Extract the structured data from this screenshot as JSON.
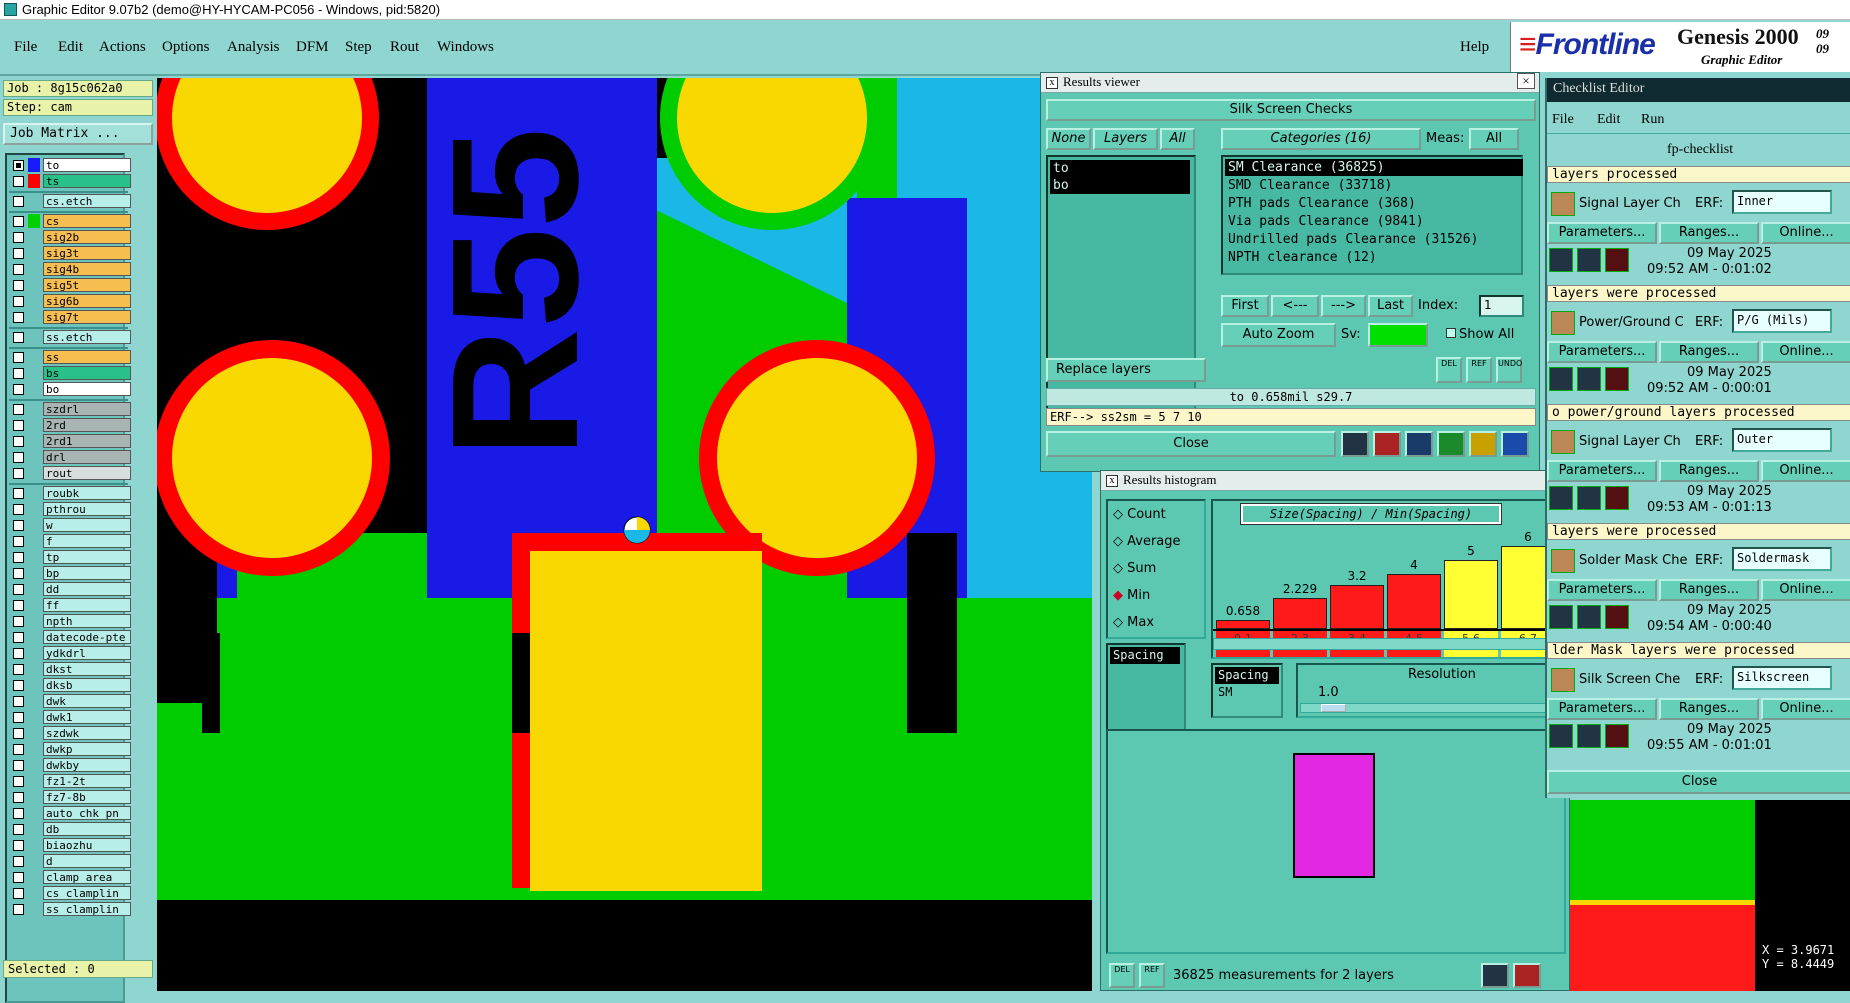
{
  "titlebar": {
    "title": "Graphic Editor 9.07b2 (demo@HY-HYCAM-PC056 - Windows, pid:5820)"
  },
  "menu": {
    "items": [
      "File",
      "Edit",
      "Actions",
      "Options",
      "Analysis",
      "DFM",
      "Step",
      "Rout",
      "Windows"
    ],
    "help": "Help"
  },
  "logo": {
    "brand": "Frontline",
    "product": "Genesis 2000",
    "subtitle": "Graphic Editor",
    "date_line1": "09",
    "date_line2": "09"
  },
  "left": {
    "job": "Job : 8g15c062a0",
    "step": "Step: cam",
    "job_matrix": "Job Matrix ...",
    "selected": "Selected : 0",
    "layers": [
      {
        "name": "to",
        "style": "wht",
        "color": "#1a1aff",
        "on": true
      },
      {
        "name": "ts",
        "style": "sol",
        "color": "#ff0000",
        "on": false
      },
      {
        "name": "cs.etch",
        "style": "cyn",
        "color": "",
        "on": false
      },
      {
        "name": "cs",
        "style": "sig",
        "color": "#00d000",
        "on": false
      },
      {
        "name": "sig2b",
        "style": "sig",
        "color": "",
        "on": false
      },
      {
        "name": "sig3t",
        "style": "sig",
        "color": "",
        "on": false
      },
      {
        "name": "sig4b",
        "style": "sig",
        "color": "",
        "on": false
      },
      {
        "name": "sig5t",
        "style": "sig",
        "color": "",
        "on": false
      },
      {
        "name": "sig6b",
        "style": "sig",
        "color": "",
        "on": false
      },
      {
        "name": "sig7t",
        "style": "sig",
        "color": "",
        "on": false
      },
      {
        "name": "ss.etch",
        "style": "cyn",
        "color": "",
        "on": false
      },
      {
        "name": "ss",
        "style": "sig",
        "color": "",
        "on": false
      },
      {
        "name": "bs",
        "style": "sol",
        "color": "",
        "on": false
      },
      {
        "name": "bo",
        "style": "wht",
        "color": "",
        "on": false
      },
      {
        "name": "szdrl",
        "style": "drl",
        "color": "",
        "on": false
      },
      {
        "name": "2rd",
        "style": "drl",
        "color": "",
        "on": false
      },
      {
        "name": "2rd1",
        "style": "drl",
        "color": "",
        "on": false
      },
      {
        "name": "drl",
        "style": "drl",
        "color": "",
        "on": false
      },
      {
        "name": "rout",
        "style": "grey",
        "color": "",
        "on": false
      },
      {
        "name": "roubk",
        "style": "cyn",
        "color": "",
        "on": false
      },
      {
        "name": "pthrou",
        "style": "cyn",
        "color": "",
        "on": false
      },
      {
        "name": "w",
        "style": "cyn",
        "color": "",
        "on": false
      },
      {
        "name": "f",
        "style": "cyn",
        "color": "",
        "on": false
      },
      {
        "name": "tp",
        "style": "cyn",
        "color": "",
        "on": false
      },
      {
        "name": "bp",
        "style": "cyn",
        "color": "",
        "on": false
      },
      {
        "name": "dd",
        "style": "cyn",
        "color": "",
        "on": false
      },
      {
        "name": "ff",
        "style": "cyn",
        "color": "",
        "on": false
      },
      {
        "name": "npth",
        "style": "cyn",
        "color": "",
        "on": false
      },
      {
        "name": "datecode-pte",
        "style": "cyn",
        "color": "",
        "on": false
      },
      {
        "name": "ydkdrl",
        "style": "cyn",
        "color": "",
        "on": false
      },
      {
        "name": "dkst",
        "style": "cyn",
        "color": "",
        "on": false
      },
      {
        "name": "dksb",
        "style": "cyn",
        "color": "",
        "on": false
      },
      {
        "name": "dwk",
        "style": "cyn",
        "color": "",
        "on": false
      },
      {
        "name": "dwk1",
        "style": "cyn",
        "color": "",
        "on": false
      },
      {
        "name": "szdwk",
        "style": "cyn",
        "color": "",
        "on": false
      },
      {
        "name": "dwkp",
        "style": "cyn",
        "color": "",
        "on": false
      },
      {
        "name": "dwkby",
        "style": "cyn",
        "color": "",
        "on": false
      },
      {
        "name": "fz1-2t",
        "style": "cyn",
        "color": "",
        "on": false
      },
      {
        "name": "fz7-8b",
        "style": "cyn",
        "color": "",
        "on": false
      },
      {
        "name": "auto_chk_pn",
        "style": "cyn",
        "color": "",
        "on": false
      },
      {
        "name": "db",
        "style": "cyn",
        "color": "",
        "on": false
      },
      {
        "name": "biaozhu",
        "style": "cyn",
        "color": "",
        "on": false
      },
      {
        "name": "d",
        "style": "cyn",
        "color": "",
        "on": false
      },
      {
        "name": "clamp_area",
        "style": "cyn",
        "color": "",
        "on": false
      },
      {
        "name": "cs_clamplin",
        "style": "cyn",
        "color": "",
        "on": false
      },
      {
        "name": "ss_clamplin",
        "style": "cyn",
        "color": "",
        "on": false
      }
    ]
  },
  "canvas": {
    "text": "R55"
  },
  "results_viewer": {
    "title": "Results viewer",
    "section": "Silk Screen Checks",
    "btn_none": "None",
    "btn_layers": "Layers",
    "btn_all": "All",
    "categories_label": "Categories (16)",
    "meas_label": "Meas:",
    "meas_value": "All",
    "layers": [
      "to",
      "bo"
    ],
    "categories": [
      "SM Clearance (36825)",
      "SMD Clearance (33718)",
      "PTH pads Clearance (368)",
      "Via pads Clearance (9841)",
      "Undrilled pads Clearance (31526)",
      "NPTH clearance (12)"
    ],
    "nav": {
      "first": "First",
      "prev": "<---",
      "next": "--->",
      "last": "Last",
      "index_label": "Index:",
      "index_value": "1"
    },
    "auto_zoom": "Auto Zoom",
    "sv_label": "Sv:",
    "show_all": "Show All",
    "replace_layers": "Replace layers",
    "status": "to 0.658mil  s29.7",
    "erf": "ERF--> ss2sm = 5 7 10",
    "close": "Close",
    "tb_del": "DEL",
    "tb_ref": "REF",
    "tb_undo": "UNDO"
  },
  "histogram": {
    "title": "Results histogram",
    "options": [
      "Count",
      "Average",
      "Sum",
      "Min",
      "Max"
    ],
    "selected_option": "Min",
    "header": "Size(Spacing) / Min(Spacing)",
    "list_item": "Spacing",
    "bars": [
      {
        "bin": "0-1",
        "value": "0.658",
        "color": "#ff1a1a"
      },
      {
        "bin": "2-3",
        "value": "2.229",
        "color": "#ff1a1a"
      },
      {
        "bin": "3-4",
        "value": "3.2",
        "color": "#ff1a1a"
      },
      {
        "bin": "4-5",
        "value": "4",
        "color": "#ff1a1a"
      },
      {
        "bin": "5-6",
        "value": "5",
        "color": "#ffff33"
      },
      {
        "bin": "6-7",
        "value": "6",
        "color": "#ffff33"
      }
    ],
    "small_list": [
      "Spacing",
      "SM"
    ],
    "resolution_label": "Resolution",
    "resolution_value": "1.0",
    "footer": "36825 measurements for 2 layers",
    "tb_del": "DEL",
    "tb_ref": "REF"
  },
  "checklist": {
    "title": "Checklist Editor",
    "menu": [
      "File",
      "Edit",
      "Run"
    ],
    "name": "fp-checklist",
    "items": [
      {
        "top_msg": "layers processed",
        "label": "Signal Layer Ch",
        "erf": "Inner",
        "date": "09 May 2025",
        "time": "09:52 AM - 0:01:02"
      },
      {
        "top_msg": "layers were processed",
        "label": "Power/Ground C",
        "erf": "P/G (Mils)",
        "date": "09 May 2025",
        "time": "09:52 AM - 0:00:01"
      },
      {
        "top_msg": "o power/ground layers processed",
        "label": "Signal Layer Ch",
        "erf": "Outer",
        "date": "09 May 2025",
        "time": "09:53 AM - 0:01:13"
      },
      {
        "top_msg": "layers were processed",
        "label": "Solder Mask Che",
        "erf": "Soldermask",
        "date": "09 May 2025",
        "time": "09:54 AM - 0:00:40"
      },
      {
        "top_msg": "lder Mask layers were processed",
        "label": "Silk Screen Che",
        "erf": "Silkscreen",
        "date": "09 May 2025",
        "time": "09:55 AM - 0:01:01"
      }
    ],
    "erf_label": "ERF:",
    "params": "Parameters...",
    "ranges": "Ranges...",
    "online": "Online...",
    "close": "Close"
  },
  "coords": {
    "x": "X = 3.9671",
    "y": "Y = 8.4449"
  }
}
